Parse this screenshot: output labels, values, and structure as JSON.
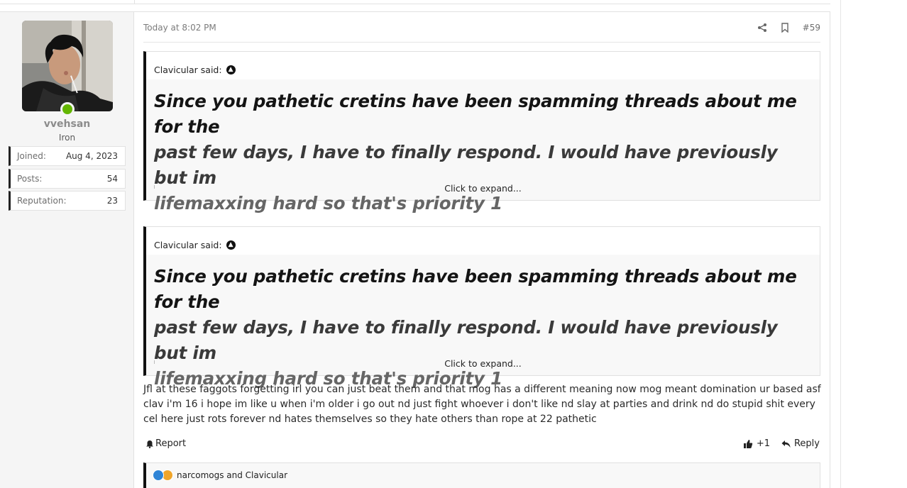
{
  "user": {
    "username": "vvehsan",
    "title": "Iron",
    "stats": [
      {
        "label": "Joined:",
        "value": "Aug 4, 2023"
      },
      {
        "label": "Posts:",
        "value": "54"
      },
      {
        "label": "Reputation:",
        "value": "23"
      }
    ]
  },
  "post": {
    "timestamp": "Today at 8:02 PM",
    "number": "#59",
    "quotes": [
      {
        "author": "Clavicular said:",
        "line1": "Since you pathetic cretins have been spamming threads about me for the",
        "line2": "past few days, I have to finally respond. I would have previously but im",
        "line3": "lifemaxxing hard so that's priority 1",
        "expand": "Click to expand..."
      },
      {
        "author": "Clavicular said:",
        "line1": "Since you pathetic cretins have been spamming threads about me for the",
        "line2": "past few days, I have to finally respond. I would have previously but im",
        "line3": "lifemaxxing hard so that's priority 1",
        "expand": "Click to expand..."
      }
    ],
    "message": "Jfl at these faggots forgetting irl you can just beat them and that mog has a different meaning now mog meant domination ur based asf clav i'm 16 i hope im like u when i'm older i go out nd just fight whoever i don't like nd slay at parties and drink nd do stupid shit every cel here just rots forever nd hates themselves so they hate others than rope at 22 pathetic",
    "report_label": "Report",
    "like_count": "+1",
    "reply_label": "Reply",
    "reactions_text": "narcomogs and Clavicular"
  },
  "colors": {
    "online": "#63b600",
    "quote_border": "#111111",
    "like_reaction": "#2f84d6",
    "funny_reaction": "#f0a52a"
  }
}
